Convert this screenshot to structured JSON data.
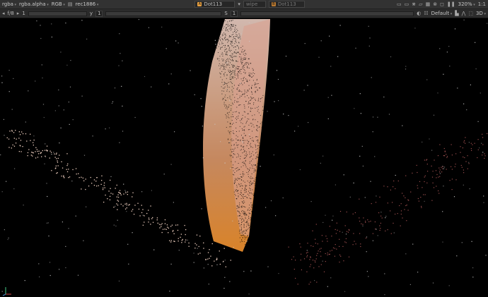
{
  "toolbar1": {
    "channels": "rgba",
    "alpha": "rgba.alpha",
    "colorspace": "RGB",
    "lut": "rec1886",
    "input_a": "Dot113",
    "input_a_letter": "A",
    "wipe": "wipe",
    "input_b": "Dot113",
    "input_b_letter": "B",
    "zoom": "320%",
    "ratio": "1:1"
  },
  "toolbar2": {
    "frame_label": "f/8",
    "frame_value": "1",
    "y_label": "y",
    "y_value": "1",
    "s_label": "S",
    "s_value": "1",
    "view": "Default",
    "mode": "3D"
  },
  "colors": {
    "accent_a": "#e8a040",
    "accent_b": "#e8a040",
    "point": "#f0c8a0"
  }
}
